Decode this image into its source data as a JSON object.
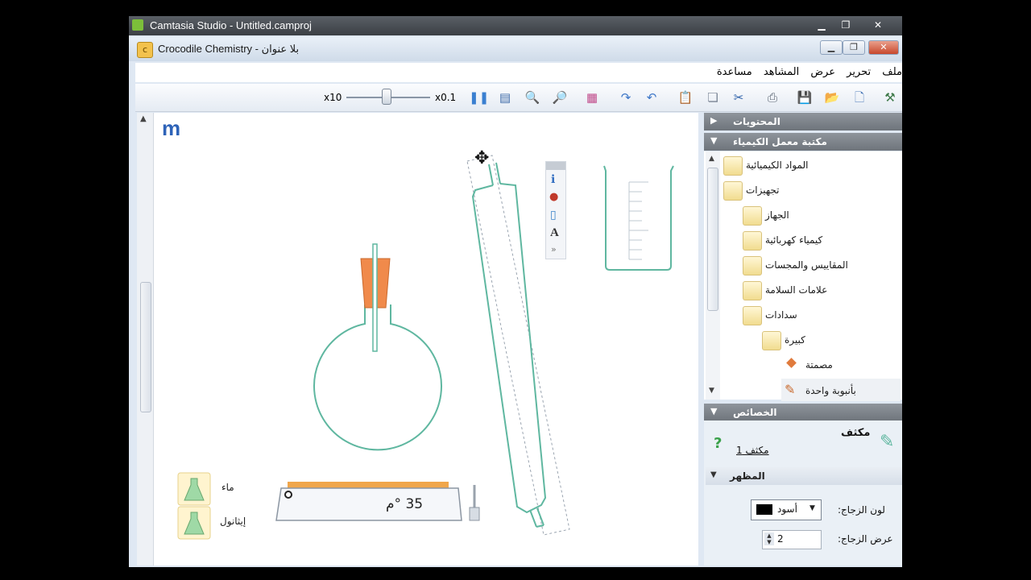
{
  "outer_window": {
    "title": "Camtasia Studio - Untitled.camproj"
  },
  "inner_window": {
    "title": "Crocodile Chemistry - بلا عنوان",
    "icon_letter": "c"
  },
  "menu": {
    "items": [
      "ملف",
      "تحرير",
      "عرض",
      "المشاهد",
      "مساعدة"
    ]
  },
  "toolbar": {
    "speed_max": "x10",
    "speed_min": "x0.1"
  },
  "canvas": {
    "logo_letter": "m",
    "hotplate_temp": "35 °م",
    "legend": {
      "water": "ماء",
      "ethanol": "إيثانول"
    },
    "label_text_tool": "A",
    "more_tools": "»"
  },
  "side_panel": {
    "contents_header": "المحتويات",
    "library_header": "مكتبة معمل الكيمياء",
    "tree": [
      {
        "label": "المواد الكيميائية"
      },
      {
        "label": "تجهيزات"
      },
      {
        "label": "الجهاز"
      },
      {
        "label": "كيمياء كهربائية"
      },
      {
        "label": "المقاييس والمجسات"
      },
      {
        "label": "علامات السلامة"
      },
      {
        "label": "سدادات"
      },
      {
        "label": "كبيرة"
      },
      {
        "label": "مصمتة"
      },
      {
        "label": "بأنبوبة واحدة"
      }
    ],
    "properties_header": "الخصائص",
    "properties": {
      "object_name": "مكثف",
      "object_instance": "مكثف 1",
      "appearance_header": "المظهر",
      "glass_color_label": "لون الزجاج:",
      "glass_color_value": "أسود",
      "glass_width_label": "عرض الزجاج:",
      "glass_width_value": "2"
    }
  },
  "colors": {
    "glass": "#5fb7a0",
    "stopper": "#f08a4b",
    "hotplate_top": "#f0a64b"
  }
}
